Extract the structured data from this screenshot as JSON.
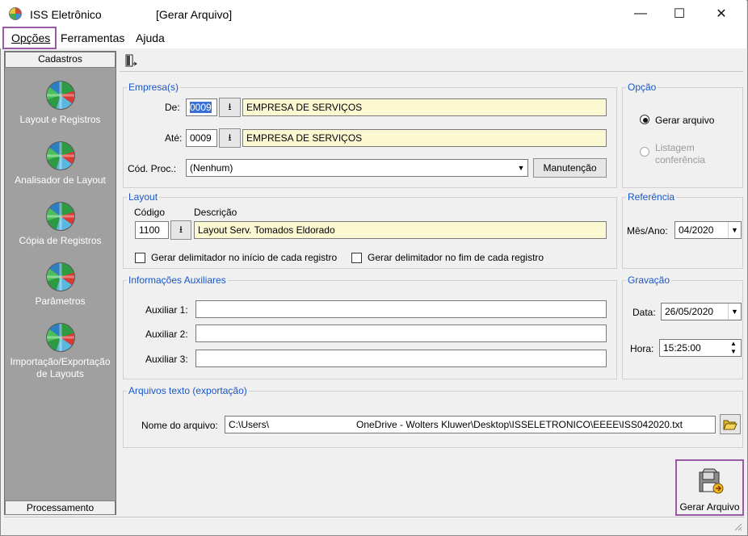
{
  "window": {
    "app_title": "ISS Eletrônico",
    "doc_title": "[Gerar Arquivo]",
    "minimize": "—",
    "maximize": "☐",
    "close": "✕"
  },
  "menu": [
    {
      "label": "Opções"
    },
    {
      "label": "Ferramentas"
    },
    {
      "label": "Ajuda"
    }
  ],
  "sidebar": {
    "header": "Cadastros",
    "items": [
      {
        "label": "Layout e Registros"
      },
      {
        "label": "Analisador de Layout"
      },
      {
        "label": "Cópia de Registros"
      },
      {
        "label": "Parâmetros"
      },
      {
        "label": "Importação/Exportação de Layouts"
      }
    ],
    "footer": "Processamento"
  },
  "empresas": {
    "legend": "Empresa(s)",
    "de_label": "De:",
    "de_code": "0009",
    "de_name": "EMPRESA DE SERVIÇOS",
    "ate_label": "Até:",
    "ate_code": "0009",
    "ate_name": "EMPRESA DE SERVIÇOS",
    "cod_proc_label": "Cód. Proc.:",
    "cod_proc_value": "(Nenhum)",
    "manutencao": "Manutenção"
  },
  "opcao": {
    "legend": "Opção",
    "gerar": "Gerar arquivo",
    "listagem": "Listagem conferência"
  },
  "layout": {
    "legend": "Layout",
    "codigo_label": "Código",
    "descricao_label": "Descrição",
    "codigo": "1100",
    "descricao": "Layout Serv. Tomados Eldorado",
    "delim_inicio": "Gerar delimitador no início de cada registro",
    "delim_fim": "Gerar delimitador no fim de cada registro"
  },
  "referencia": {
    "legend": "Referência",
    "mes_ano_label": "Mês/Ano:",
    "mes_ano": "04/2020"
  },
  "aux": {
    "legend": "Informações Auxiliares",
    "aux1_label": "Auxiliar 1:",
    "aux2_label": "Auxiliar 2:",
    "aux3_label": "Auxiliar 3:"
  },
  "gravacao": {
    "legend": "Gravação",
    "data_label": "Data:",
    "data": "26/05/2020",
    "hora_label": "Hora:",
    "hora": "15:25:00"
  },
  "arquivos": {
    "legend": "Arquivos texto (exportação)",
    "nome_label": "Nome do arquivo:",
    "path_start": "C:\\Users\\",
    "path_end": "OneDrive - Wolters Kluwer\\Desktop\\ISSELETRONICO\\EEEE\\ISS042020.txt"
  },
  "actions": {
    "gerar": "Gerar Arquivo"
  }
}
